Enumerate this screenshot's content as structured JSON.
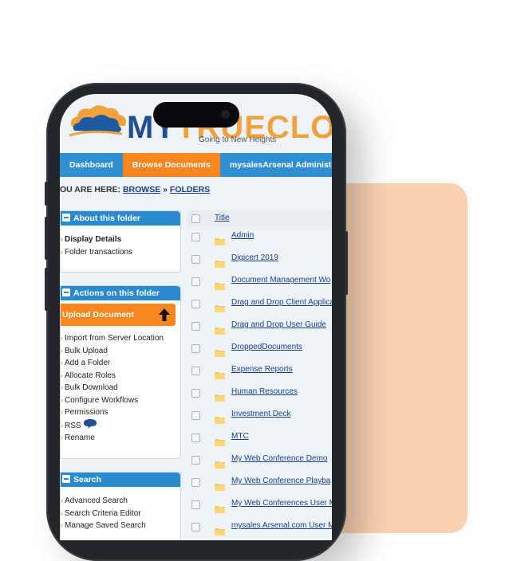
{
  "logo": {
    "my": "MY",
    "rest": "TRUECLOUD",
    "tagline": "Going to New Heights"
  },
  "nav": {
    "items": [
      "Dashboard",
      "Browse Documents",
      "mysalesArsenal Administratio"
    ]
  },
  "breadcrumb": {
    "prefix": "OU ARE HERE:",
    "browse": "BROWSE",
    "sep": "»",
    "folders": "FOLDERS"
  },
  "about_panel": {
    "title": "About this folder",
    "links": [
      "Display Details",
      "Folder transactions"
    ]
  },
  "actions_panel": {
    "title": "Actions on this folder",
    "upload_label": "Upload Document",
    "links": [
      "Import from Server Location",
      "Bulk Upload",
      "Add a Folder",
      "Allocate Roles",
      "Bulk Download",
      "Configure Workflows",
      "Permissions",
      "RSS",
      "Rename"
    ]
  },
  "search_panel": {
    "title": "Search",
    "links": [
      "Advanced Search",
      "Search Criteria Editor",
      "Manage Saved Search"
    ]
  },
  "table": {
    "header": "Title",
    "rows": [
      "Admin",
      "Digicert 2019",
      "Document Management Wo",
      "Drag and Drop Client Applica",
      "Drag and Drop User Guide",
      "DroppedDocuments",
      "Expense Reports",
      "Human Resources",
      "Investment Deck",
      "MTC",
      "My Web Conference Demo",
      "My Web Conference Playba",
      "My Web Conferences User M",
      "mysales Arsenal.com User M"
    ]
  },
  "colors": {
    "accent_blue": "#2a8ad0",
    "accent_orange": "#f7861e",
    "link": "#1a3f85",
    "peach": "#fbd2b1"
  },
  "icons": [
    "cloud-logo-icon",
    "minus-icon",
    "up-arrow-icon",
    "rss-bubble-icon",
    "folder-icon",
    "checkbox-icon"
  ]
}
